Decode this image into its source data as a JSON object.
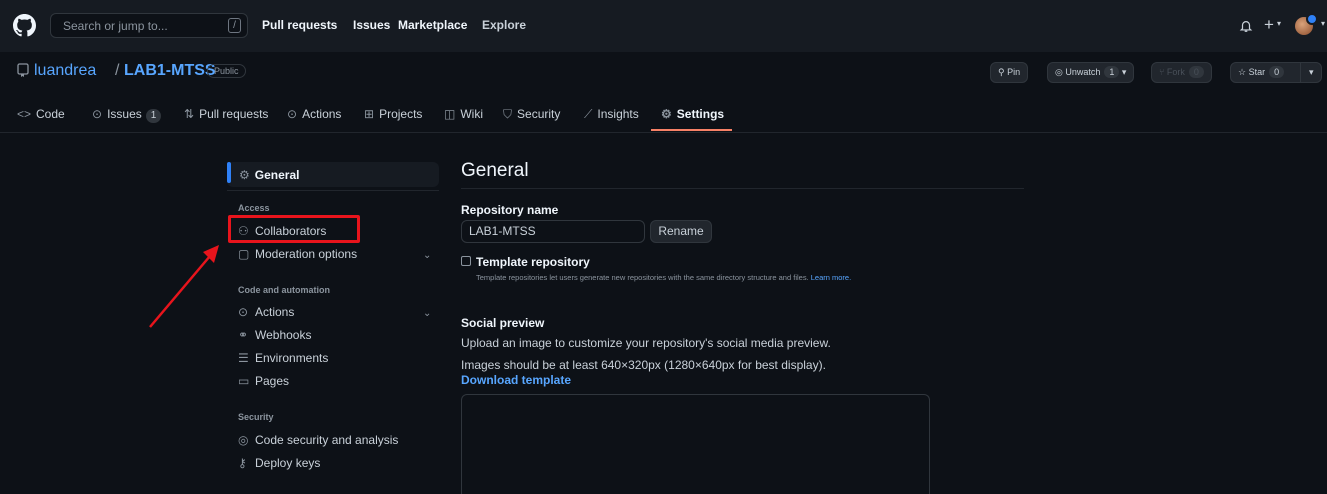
{
  "header": {
    "search_placeholder": "Search or jump to...",
    "search_key": "/",
    "nav": [
      "Pull requests",
      "Issues",
      "Marketplace",
      "Explore"
    ]
  },
  "repo": {
    "owner": "luandrea",
    "separator": "/",
    "name": "LAB1-MTSS",
    "visibility": "Public",
    "pin_label": "Pin",
    "watch_label": "Unwatch",
    "watch_count": "1",
    "fork_label": "Fork",
    "fork_count": "0",
    "star_label": "Star",
    "star_count": "0"
  },
  "tabs": {
    "code": "Code",
    "issues": "Issues",
    "issues_count": "1",
    "pulls": "Pull requests",
    "actions": "Actions",
    "projects": "Projects",
    "wiki": "Wiki",
    "security": "Security",
    "insights": "Insights",
    "settings": "Settings"
  },
  "sidebar": {
    "general": "General",
    "group_access": "Access",
    "collaborators": "Collaborators",
    "moderation": "Moderation options",
    "group_code": "Code and automation",
    "actions": "Actions",
    "webhooks": "Webhooks",
    "environments": "Environments",
    "pages": "Pages",
    "group_security": "Security",
    "code_security": "Code security and analysis",
    "deploy_keys": "Deploy keys"
  },
  "main": {
    "title": "General",
    "repo_name_label": "Repository name",
    "repo_name_value": "LAB1-MTSS",
    "rename_button": "Rename",
    "template_label": "Template repository",
    "template_help": "Template repositories let users generate new repositories with the same directory structure and files.",
    "template_link": "Learn more.",
    "social_title": "Social preview",
    "social_desc": "Upload an image to customize your repository's social media preview.",
    "social_size": "Images should be at least 640×320px (1280×640px for best display).",
    "download_template": "Download template"
  },
  "colors": {
    "background": "#0d1117",
    "header": "#161b22",
    "link": "#58a6ff",
    "tab_underline": "#f78166",
    "annotation": "#e8141c"
  },
  "icons": [
    "github-logo-icon",
    "bell-icon",
    "plus-icon",
    "repo-icon",
    "pin-icon",
    "eye-icon",
    "fork-icon",
    "star-icon",
    "code-icon",
    "issue-icon",
    "pull-request-icon",
    "play-icon",
    "table-icon",
    "book-icon",
    "shield-icon",
    "graph-icon",
    "gear-icon",
    "people-icon",
    "comment-icon",
    "webhook-icon",
    "server-icon",
    "browser-icon",
    "codescan-icon",
    "key-icon"
  ]
}
